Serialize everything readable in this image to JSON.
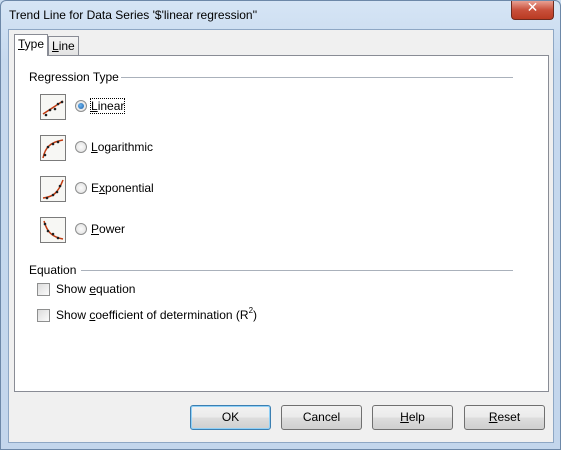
{
  "window": {
    "title": "Trend Line for Data Series '$'linear regression''",
    "close_glyph": "✕"
  },
  "tabs": [
    {
      "label_prefix": "",
      "label_mnemonic": "T",
      "label_suffix": "ype",
      "active": true
    },
    {
      "label_prefix": "",
      "label_mnemonic": "L",
      "label_suffix": "ine",
      "active": false
    }
  ],
  "regression": {
    "section_title": "Regression Type",
    "options": [
      {
        "icon": "linear-regression-icon",
        "pre": "",
        "mn": "L",
        "post": "inear",
        "selected": true
      },
      {
        "icon": "logarithmic-regression-icon",
        "pre": "",
        "mn": "L",
        "post": "ogarithmic",
        "selected": false
      },
      {
        "icon": "exponential-regression-icon",
        "pre": "E",
        "mn": "x",
        "post": "ponential",
        "selected": false
      },
      {
        "icon": "power-regression-icon",
        "pre": "",
        "mn": "P",
        "post": "ower",
        "selected": false
      }
    ]
  },
  "equation": {
    "section_title": "Equation",
    "show_equation": {
      "pre": "Show ",
      "mn": "e",
      "post": "quation",
      "checked": false
    },
    "show_r2": {
      "pre": "Show ",
      "mn": "c",
      "post": "oefficient of determination (R",
      "sup": "2",
      "tail": ")",
      "checked": false
    }
  },
  "buttons": {
    "ok": {
      "pre": "OK",
      "mn": "",
      "post": ""
    },
    "cancel": {
      "pre": "Cancel",
      "mn": "",
      "post": ""
    },
    "help": {
      "pre": "",
      "mn": "H",
      "post": "elp"
    },
    "reset": {
      "pre": "",
      "mn": "R",
      "post": "eset"
    }
  },
  "colors": {
    "trend_line": "#c03a10",
    "points": "#202020",
    "default_button_border": "#3c7fb1"
  }
}
